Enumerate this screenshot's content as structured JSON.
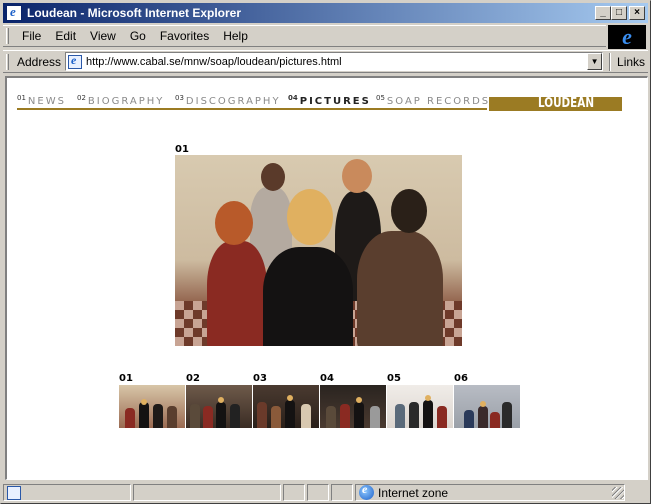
{
  "window": {
    "title": "Loudean - Microsoft Internet Explorer",
    "minimize_glyph": "_",
    "maximize_glyph": "□",
    "close_glyph": "×"
  },
  "menu": {
    "items": [
      {
        "label": "File"
      },
      {
        "label": "Edit"
      },
      {
        "label": "View"
      },
      {
        "label": "Go"
      },
      {
        "label": "Favorites"
      },
      {
        "label": "Help"
      }
    ]
  },
  "address": {
    "label": "Address",
    "url": "http://www.cabal.se/mnw/soap/loudean/pictures.html",
    "links_label": "Links"
  },
  "site": {
    "brand": "LOUDEAN",
    "accent_color": "#9b7b23",
    "nav": [
      {
        "num": "01",
        "label": "NEWS"
      },
      {
        "num": "02",
        "label": "BIOGRAPHY"
      },
      {
        "num": "03",
        "label": "DISCOGRAPHY"
      },
      {
        "num": "04",
        "label": "PICTURES"
      },
      {
        "num": "05",
        "label": "SOAP RECORDS"
      }
    ],
    "active_nav": "PICTURES",
    "main_photo_number": "01",
    "thumbnails": [
      {
        "num": "01"
      },
      {
        "num": "02"
      },
      {
        "num": "03"
      },
      {
        "num": "04"
      },
      {
        "num": "05"
      },
      {
        "num": "06"
      }
    ]
  },
  "status": {
    "zone": "Internet zone"
  }
}
